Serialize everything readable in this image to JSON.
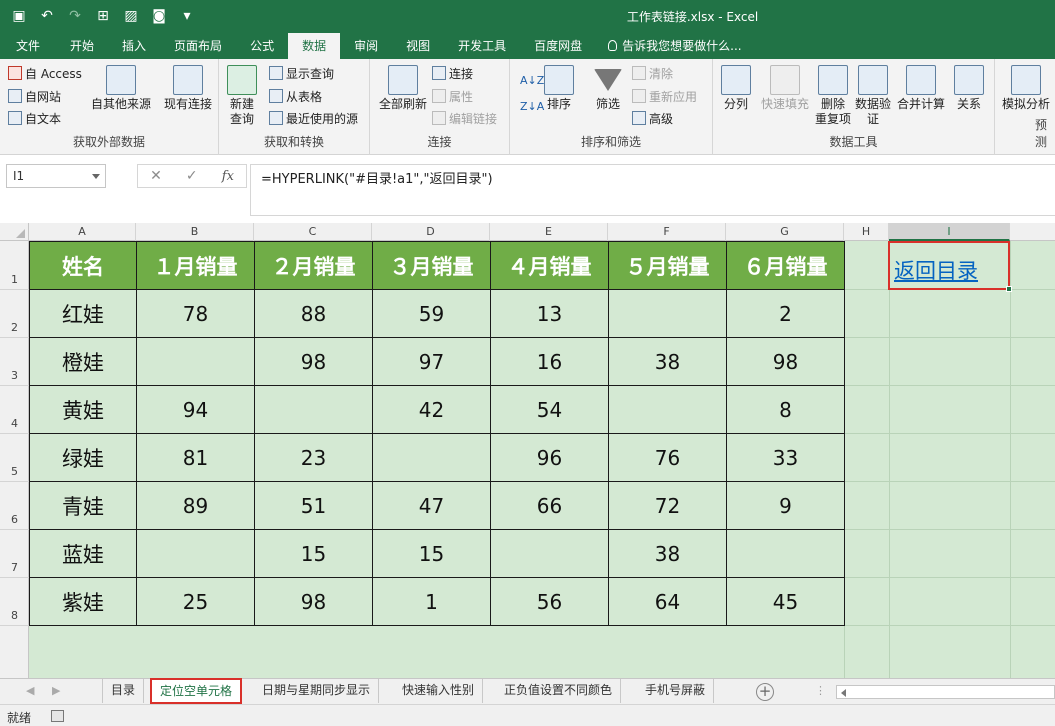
{
  "window": {
    "title": "工作表链接.xlsx - Excel"
  },
  "qat": [
    "save-icon",
    "undo-icon",
    "redo-icon",
    "form-icon",
    "photo-icon",
    "camera-icon",
    "customize-icon"
  ],
  "ribbon_tabs": [
    "文件",
    "开始",
    "插入",
    "页面布局",
    "公式",
    "数据",
    "审阅",
    "视图",
    "开发工具",
    "百度网盘"
  ],
  "active_tab": "数据",
  "tell_me": "告诉我您想要做什么...",
  "ribbon": {
    "get_external": {
      "label": "获取外部数据",
      "access": "自 Access",
      "web": "自网站",
      "text": "自文本",
      "other": "自其他来源",
      "existing": "现有连接"
    },
    "get_transform": {
      "label": "获取和转换",
      "new_query_1": "新建",
      "new_query_2": "查询",
      "show_queries": "显示查询",
      "from_table": "从表格",
      "recent_sources": "最近使用的源"
    },
    "connections": {
      "label": "连接",
      "refresh_all": "全部刷新",
      "connections": "连接",
      "properties": "属性",
      "edit_links": "编辑链接"
    },
    "sort_filter": {
      "label": "排序和筛选",
      "sort": "排序",
      "filter": "筛选",
      "clear": "清除",
      "reapply": "重新应用",
      "advanced": "高级"
    },
    "data_tools": {
      "label": "数据工具",
      "text_to_columns": "分列",
      "flash_fill": "快速填充",
      "remove_dup_1": "删除",
      "remove_dup_2": "重复项",
      "validation_1": "数据验",
      "validation_2": "证",
      "consolidate": "合并计算",
      "relationships": "关系"
    },
    "forecast": {
      "label": "预测",
      "what_if": "模拟分析"
    }
  },
  "formula_bar": {
    "name_box": "I1",
    "cancel": "✕",
    "enter": "✓",
    "fx": "fx",
    "formula": "=HYPERLINK(\"#目录!a1\",\"返回目录\")"
  },
  "columns": [
    "A",
    "B",
    "C",
    "D",
    "E",
    "F",
    "G",
    "H",
    "I"
  ],
  "selected_column": "I",
  "rows": [
    "1",
    "2",
    "3",
    "4",
    "5",
    "6",
    "7",
    "8"
  ],
  "table": {
    "headers": [
      "姓名",
      "１月销量",
      "２月销量",
      "３月销量",
      "４月销量",
      "５月销量",
      "６月销量"
    ],
    "rows": [
      [
        "红娃",
        "78",
        "88",
        "59",
        "13",
        "",
        "2"
      ],
      [
        "橙娃",
        "",
        "98",
        "97",
        "16",
        "38",
        "98"
      ],
      [
        "黄娃",
        "94",
        "",
        "42",
        "54",
        "",
        "8"
      ],
      [
        "绿娃",
        "81",
        "23",
        "",
        "96",
        "76",
        "33"
      ],
      [
        "青娃",
        "89",
        "51",
        "47",
        "66",
        "72",
        "9"
      ],
      [
        "蓝娃",
        "",
        "15",
        "15",
        "",
        "38",
        ""
      ],
      [
        "紫娃",
        "25",
        "98",
        "1",
        "56",
        "64",
        "45"
      ]
    ]
  },
  "hyperlink": {
    "text": "返回目录"
  },
  "sheets": [
    "目录",
    "定位空单元格",
    "日期与星期同步显示",
    "快速输入性别",
    "正负值设置不同颜色",
    "手机号屏蔽"
  ],
  "active_sheet": "定位空单元格",
  "status": {
    "ready": "就绪"
  },
  "colors": {
    "excel_green": "#217346",
    "header_fill": "#70ad47",
    "cell_fill": "#d4e9d3",
    "highlight_red": "#d9302a",
    "link_blue": "#0563c1"
  }
}
